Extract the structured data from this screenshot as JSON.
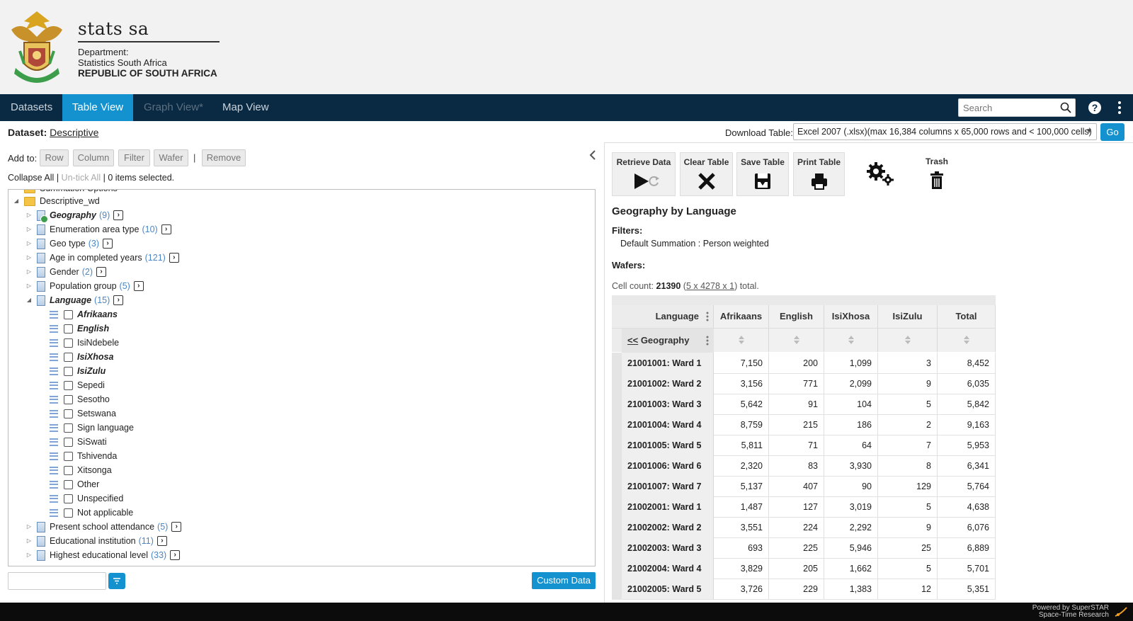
{
  "brand": {
    "name": "stats sa",
    "line1": "Department:",
    "line2": "Statistics South Africa",
    "line3": "REPUBLIC OF SOUTH AFRICA"
  },
  "nav": {
    "tabs": [
      {
        "label": "Datasets"
      },
      {
        "label": "Table View"
      },
      {
        "label": "Graph View*"
      },
      {
        "label": "Map View"
      }
    ],
    "search_placeholder": "Search"
  },
  "dataset": {
    "label": "Dataset:",
    "name": "Descriptive"
  },
  "download": {
    "label": "Download Table:",
    "selected": "Excel 2007 (.xlsx)(max 16,384 columns x 65,000 rows and < 100,000 cells)",
    "go": "Go"
  },
  "addto": {
    "label": "Add to:",
    "row": "Row",
    "column": "Column",
    "filter": "Filter",
    "wafer": "Wafer",
    "separator": "|",
    "remove": "Remove"
  },
  "selection": {
    "collapse_all": "Collapse All",
    "sep1": "|",
    "untick_all": "Un-tick All",
    "sep2": "|",
    "status": "0 items selected."
  },
  "tree": {
    "partial": "Summation Options",
    "root": "Descriptive_wd",
    "variables_top": [
      {
        "label": "Geography",
        "count": "(9)"
      },
      {
        "label": "Enumeration area type",
        "count": "(10)"
      },
      {
        "label": "Geo type",
        "count": "(3)"
      },
      {
        "label": "Age in completed years",
        "count": "(121)"
      },
      {
        "label": "Gender",
        "count": "(2)"
      },
      {
        "label": "Population group",
        "count": "(5)"
      },
      {
        "label": "Language",
        "count": "(15)"
      }
    ],
    "language_items": [
      "Afrikaans",
      "English",
      "IsiNdebele",
      "IsiXhosa",
      "IsiZulu",
      "Sepedi",
      "Sesotho",
      "Setswana",
      "Sign language",
      "SiSwati",
      "Tshivenda",
      "Xitsonga",
      "Other",
      "Unspecified",
      "Not applicable"
    ],
    "variables_bottom": [
      {
        "label": "Present school attendance",
        "count": "(5)"
      },
      {
        "label": "Educational institution",
        "count": "(11)"
      },
      {
        "label": "Highest educational level",
        "count": "(33)"
      }
    ]
  },
  "custom_data_label": "Custom Data",
  "tools": {
    "retrieve": "Retrieve Data",
    "clear": "Clear Table",
    "save": "Save Table",
    "print": "Print Table",
    "trash": "Trash"
  },
  "table": {
    "title": "Geography by Language",
    "filters_label": "Filters:",
    "filters_value": "Default Summation : Person weighted",
    "wafers_label": "Wafers:",
    "cellcount_prefix": "Cell count:",
    "cellcount_value": "21390",
    "cellcount_dims": "5 x 4278 x 1",
    "cellcount_suffix": "total.",
    "column_var": "Language",
    "row_var_prefix": "<<",
    "row_var": "Geography",
    "columns": [
      "Afrikaans",
      "English",
      "IsiXhosa",
      "IsiZulu",
      "Total"
    ],
    "rows": [
      {
        "label": "21001001: Ward 1",
        "values": [
          "7,150",
          "200",
          "1,099",
          "3",
          "8,452"
        ]
      },
      {
        "label": "21001002: Ward 2",
        "values": [
          "3,156",
          "771",
          "2,099",
          "9",
          "6,035"
        ]
      },
      {
        "label": "21001003: Ward 3",
        "values": [
          "5,642",
          "91",
          "104",
          "5",
          "5,842"
        ]
      },
      {
        "label": "21001004: Ward 4",
        "values": [
          "8,759",
          "215",
          "186",
          "2",
          "9,163"
        ]
      },
      {
        "label": "21001005: Ward 5",
        "values": [
          "5,811",
          "71",
          "64",
          "7",
          "5,953"
        ]
      },
      {
        "label": "21001006: Ward 6",
        "values": [
          "2,320",
          "83",
          "3,930",
          "8",
          "6,341"
        ]
      },
      {
        "label": "21001007: Ward 7",
        "values": [
          "5,137",
          "407",
          "90",
          "129",
          "5,764"
        ]
      },
      {
        "label": "21002001: Ward 1",
        "values": [
          "1,487",
          "127",
          "3,019",
          "5",
          "4,638"
        ]
      },
      {
        "label": "21002002: Ward 2",
        "values": [
          "3,551",
          "224",
          "2,292",
          "9",
          "6,076"
        ]
      },
      {
        "label": "21002003: Ward 3",
        "values": [
          "693",
          "225",
          "5,946",
          "25",
          "6,889"
        ]
      },
      {
        "label": "21002004: Ward 4",
        "values": [
          "3,829",
          "205",
          "1,662",
          "5",
          "5,701"
        ]
      },
      {
        "label": "21002005: Ward 5",
        "values": [
          "3,726",
          "229",
          "1,383",
          "12",
          "5,351"
        ]
      }
    ]
  },
  "footer": {
    "line1": "Powered by SuperSTAR",
    "line2": "Space-Time Research"
  },
  "colors": {
    "nav_bg": "#0a2a43",
    "accent": "#1492cf",
    "footer_bg": "#0c0c0c"
  }
}
